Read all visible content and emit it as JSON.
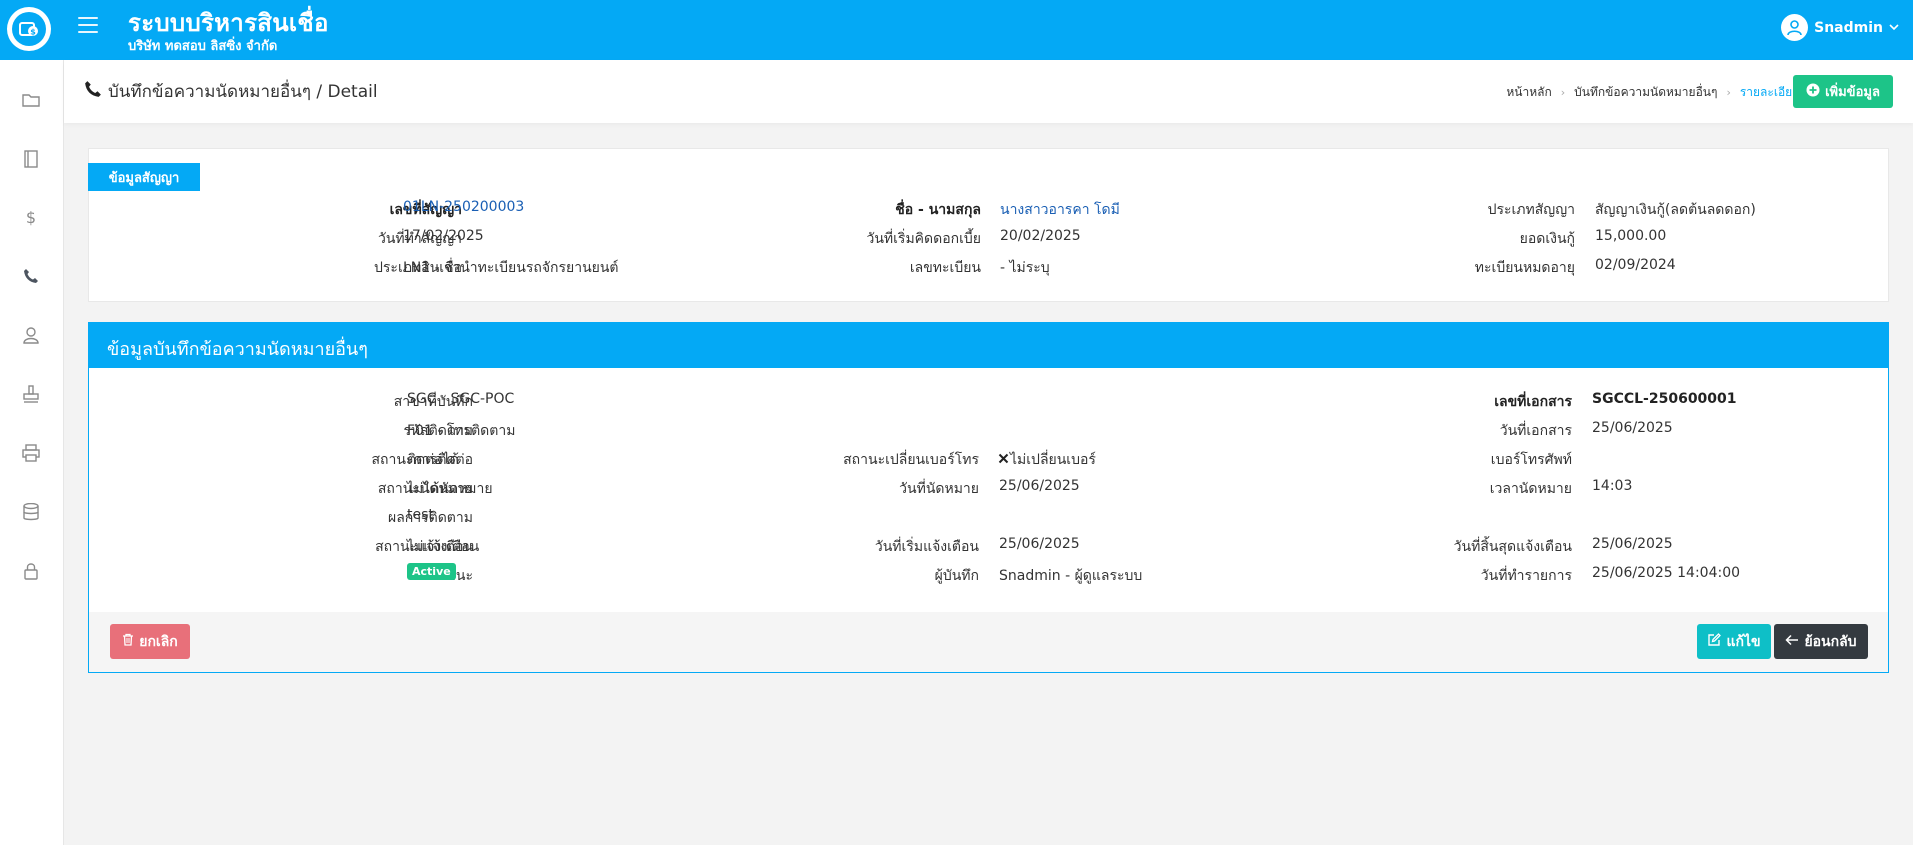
{
  "app": {
    "title": "ระบบบริหารสินเชื่อ",
    "company": "บริษัท ทดสอบ ลิสซิ่ง จำกัด",
    "user": "Snadmin"
  },
  "header": {
    "title": "บันทึกข้อความนัดหมายอื่นๆ / Detail",
    "breadcrumb": [
      "หน้าหลัก",
      "บันทึกข้อความนัดหมายอื่นๆ",
      "รายละเอียด"
    ],
    "add_label": "เพิ่มข้อมูล"
  },
  "sidebar": {
    "icons": [
      "folder-icon",
      "book-icon",
      "dollar-icon",
      "phone-icon",
      "user-icon",
      "stamp-icon",
      "printer-icon",
      "database-icon",
      "lock-icon"
    ]
  },
  "contract": {
    "tag": "ข้อมูลสัญญา",
    "contract_no_label": "เลขที่สัญญา",
    "contract_no": "01LN-250200003",
    "name_label": "ชื่อ - นามสกุล",
    "name": "นางสาวอารคา โดมี",
    "type_label": "ประเภทสัญญา",
    "type": "สัญญาเงินกู้(ลดต้นลดดอก)",
    "date_label": "วันที่ทำสัญญา",
    "date": "17/02/2025",
    "interest_start_label": "วันที่เริ่มคิดดอกเบี้ย",
    "interest_start": "20/02/2025",
    "loan_amount_label": "ยอดเงินกู้",
    "loan_amount": "15,000.00",
    "product_label": "ประเภทสินเชื่อ",
    "product": "LN1 - จำนำทะเบียนรถจักรยานยนต์",
    "plate_label": "เลขทะเบียน",
    "plate": "- ไม่ระบุ",
    "reg_expiry_label": "ทะเบียนหมดอายุ",
    "reg_expiry": "02/09/2024"
  },
  "detail": {
    "title": "ข้อมูลบันทึกข้อความนัดหมายอื่นๆ",
    "branch_label": "สาขาที่บันทึก",
    "branch": "SGC - SGC-POC",
    "doc_no_label": "เลขที่เอกสาร",
    "doc_no": "SGCCL-250600001",
    "track_code_label": "รหัสติดตาม",
    "track_code": "F01 - โทรติดตาม",
    "doc_date_label": "วันที่เอกสาร",
    "doc_date": "25/06/2025",
    "contact_status_label": "สถานะการติดต่อ",
    "contact_status": "ติดต่อได้",
    "phone_change_label": "สถานะเปลี่ยนเบอร์โทร",
    "phone_change": "ไม่เปลี่ยนเบอร์",
    "phone_label": "เบอร์โทรศัพท์",
    "phone": "",
    "appt_status_label": "สถานะนัดหมาย",
    "appt_status": "ไม่ได้นัดหมาย",
    "appt_date_label": "วันที่นัดหมาย",
    "appt_date": "25/06/2025",
    "appt_time_label": "เวลานัดหมาย",
    "appt_time": "14:03",
    "result_label": "ผลการติดตาม",
    "result": "test",
    "notify_status_label": "สถานะแจ้งเตือน",
    "notify_status": "ไม่แจ้งเตือน",
    "notify_start_label": "วันที่เริ่มแจ้งเตือน",
    "notify_start": "25/06/2025",
    "notify_end_label": "วันที่สิ้นสุดแจ้งเตือน",
    "notify_end": "25/06/2025",
    "status_label": "สถานะ",
    "status": "Active",
    "recorder_label": "ผู้บันทึก",
    "recorder": "Snadmin - ผู้ดูแลระบบ",
    "txn_date_label": "วันที่ทำรายการ",
    "txn_date": "25/06/2025 14:04:00",
    "cancel_label": "ยกเลิก",
    "edit_label": "แก้ไข",
    "back_label": "ย้อนกลับ"
  },
  "colors": {
    "primary": "#04a9f5",
    "success": "#1dc488",
    "danger": "#e8707a",
    "info": "#0ebfc7",
    "dark": "#343a40"
  }
}
